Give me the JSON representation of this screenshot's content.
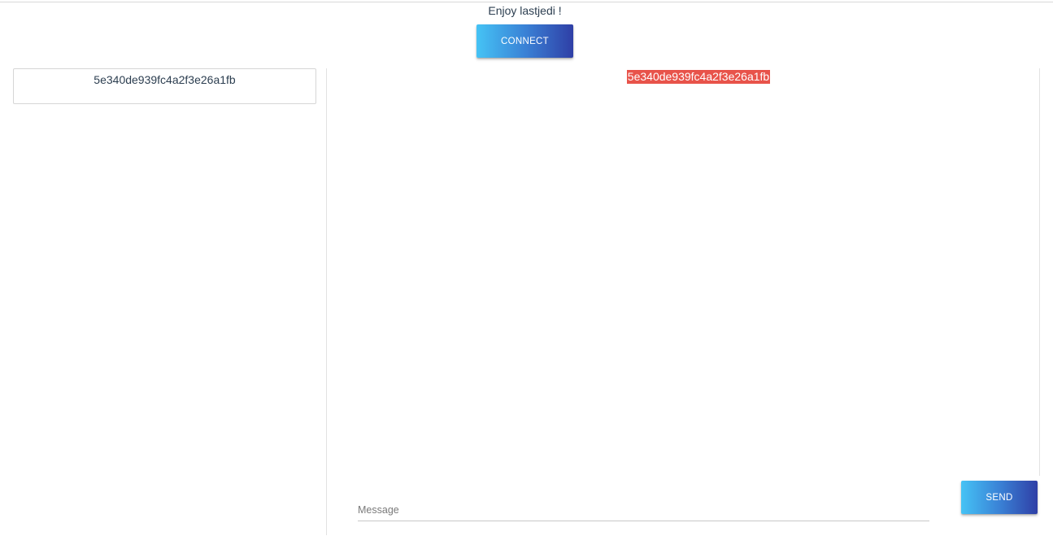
{
  "header": {
    "greeting": "Enjoy lastjedi !",
    "connect_label": "CONNECT"
  },
  "conversations": [
    {
      "id": "5e340de939fc4a2f3e26a1fb"
    }
  ],
  "chat": {
    "active_id": "5e340de939fc4a2f3e26a1fb",
    "message_placeholder": "Message",
    "message_value": "",
    "send_label": "SEND"
  },
  "colors": {
    "button_gradient_start": "#45c3f5",
    "button_gradient_end": "#2f3fa6",
    "highlight": "#e8534a",
    "text": "#2c3e50"
  }
}
